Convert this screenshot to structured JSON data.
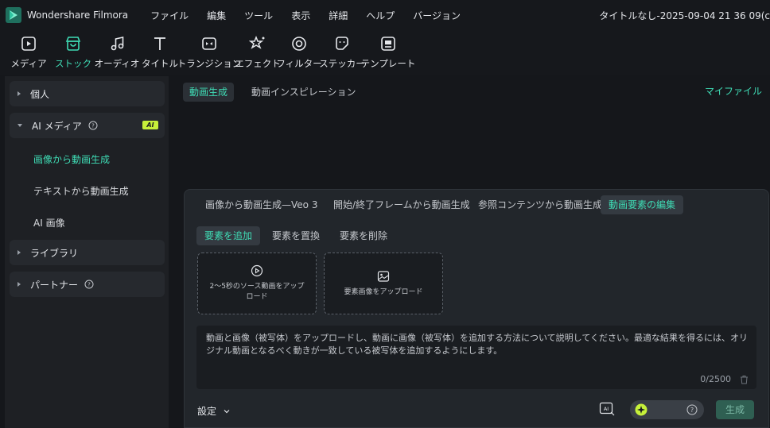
{
  "app": {
    "name": "Wondershare Filmora",
    "doc_title": "タイトルなし-2025-09-04 21 36 09(c"
  },
  "menu": [
    "ファイル",
    "編集",
    "ツール",
    "表示",
    "詳細",
    "ヘルプ",
    "バージョン"
  ],
  "toolbar": [
    {
      "label": "メディア",
      "icon": "media-icon"
    },
    {
      "label": "ストック",
      "icon": "stock-icon",
      "active": true
    },
    {
      "label": "オーディオ",
      "icon": "audio-icon"
    },
    {
      "label": "タイトル",
      "icon": "title-icon"
    },
    {
      "label": "トランジション",
      "icon": "transition-icon"
    },
    {
      "label": "エフェクト",
      "icon": "effect-icon"
    },
    {
      "label": "フィルター",
      "icon": "filter-icon"
    },
    {
      "label": "ステッカー",
      "icon": "sticker-icon"
    },
    {
      "label": "テンプレート",
      "icon": "template-icon"
    }
  ],
  "sidebar": {
    "personal": "個人",
    "ai_media": "AI メディア",
    "ai_badge": "AI",
    "sub_items": [
      "画像から動画生成",
      "テキストから動画生成",
      "AI 画像"
    ],
    "library": "ライブラリ",
    "partner": "パートナー"
  },
  "main": {
    "tabs": [
      "動画生成",
      "動画インスピレーション"
    ],
    "my_files": "マイファイル"
  },
  "panel": {
    "tabs": [
      "画像から動画生成—Veo 3",
      "開始/終了フレームから動画生成",
      "参照コンテンツから動画生成",
      "動画要素の編集"
    ],
    "subtabs": [
      "要素を追加",
      "要素を置換",
      "要素を削除"
    ],
    "upload_video": "2〜5秒のソース動画をアップロード",
    "upload_image": "要素画像をアップロード",
    "prompt": "動画と画像（被写体）をアップロードし、動画に画像（被写体）を追加する方法について説明してください。最適な結果を得るには、オリジナル動画となるべく動きが一致している被写体を追加するようにします。",
    "counter": "0/2500",
    "settings": "設定",
    "generate": "生成"
  },
  "colors": {
    "accent": "#3fdcb5",
    "ai_badge": "#c6f03a",
    "background": "#15171b"
  }
}
